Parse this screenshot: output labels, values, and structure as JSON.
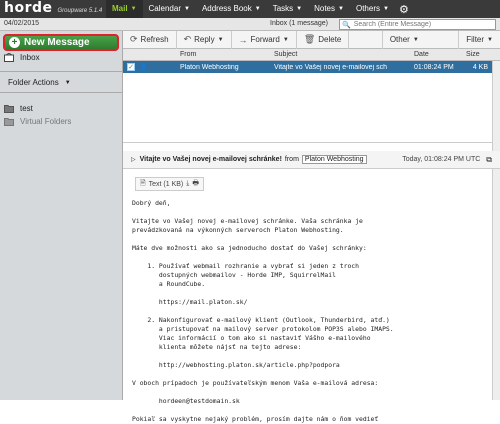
{
  "app": {
    "logo": "horde",
    "product": "Groupware 5.1.4"
  },
  "menu": [
    {
      "label": "Mail"
    },
    {
      "label": "Calendar"
    },
    {
      "label": "Address Book"
    },
    {
      "label": "Tasks"
    },
    {
      "label": "Notes"
    },
    {
      "label": "Others"
    }
  ],
  "subbar": {
    "date": "04/02/2015",
    "inbox_count": "Inbox (1 message)",
    "search_placeholder": "Search (Entire Message)"
  },
  "sidebar": {
    "new_message": "New Message",
    "inbox": "Inbox",
    "folder_actions": "Folder Actions",
    "folders": [
      "test",
      "Virtual Folders"
    ]
  },
  "toolbar": {
    "refresh": "Refresh",
    "reply": "Reply",
    "forward": "Forward",
    "delete": "Delete",
    "other": "Other",
    "filter": "Filter"
  },
  "columns": {
    "from": "From",
    "subject": "Subject",
    "date": "Date",
    "size": "Size"
  },
  "messages": [
    {
      "from": "Platon Webhosting",
      "subject": "Vitajte vo Vašej novej e-mailovej sch",
      "date": "01:08:24 PM",
      "size": "4 KB"
    }
  ],
  "preview": {
    "subject": "Vitajte vo Vašej novej e-mailovej schránke!",
    "from_label": "from",
    "from": "Platon Webhosting",
    "timestamp": "Today, 01:08:24 PM UTC",
    "attachment": "Text (1 KB)",
    "body": "Dobrý deň,\n\nVitajte vo Vašej novej e-mailovej schránke. Vaša schránka je\nprevádzkovaná na výkonných serveroch Platon Webhosting.\n\nMáte dve možnosti ako sa jednoducho dostať do Vašej schránky:\n\n    1. Používať webmail rozhranie a vybrať si jeden z troch\n       dostupných webmailov - Horde IMP, SquirrelMail\n       a RoundCube.\n\n       https://mail.platon.sk/\n\n    2. Nakonfigurovať e-mailový klient (Outlook, Thunderbird, atď.)\n       a pristupovať na mailový server protokolom POP3S alebo IMAPS.\n       Viac informácií o tom ako si nastaviť Vášho e-mailového\n       klienta môžete nájsť na tejto adrese:\n\n       http://webhosting.platon.sk/article.php?podpora\n\nV oboch prípadoch je používateľským menom Vaša e-mailová adresa:\n\n       hordeen@testdomain.sk\n\nPokiaľ sa vyskytne nejaký problém, prosím dajte nám o ňom vedieť"
  },
  "colors": {
    "accent_green": "#9acd32",
    "selected_row": "#2f6f9f",
    "new_message": "#3a8f3a",
    "highlight_border": "#e0202a"
  }
}
